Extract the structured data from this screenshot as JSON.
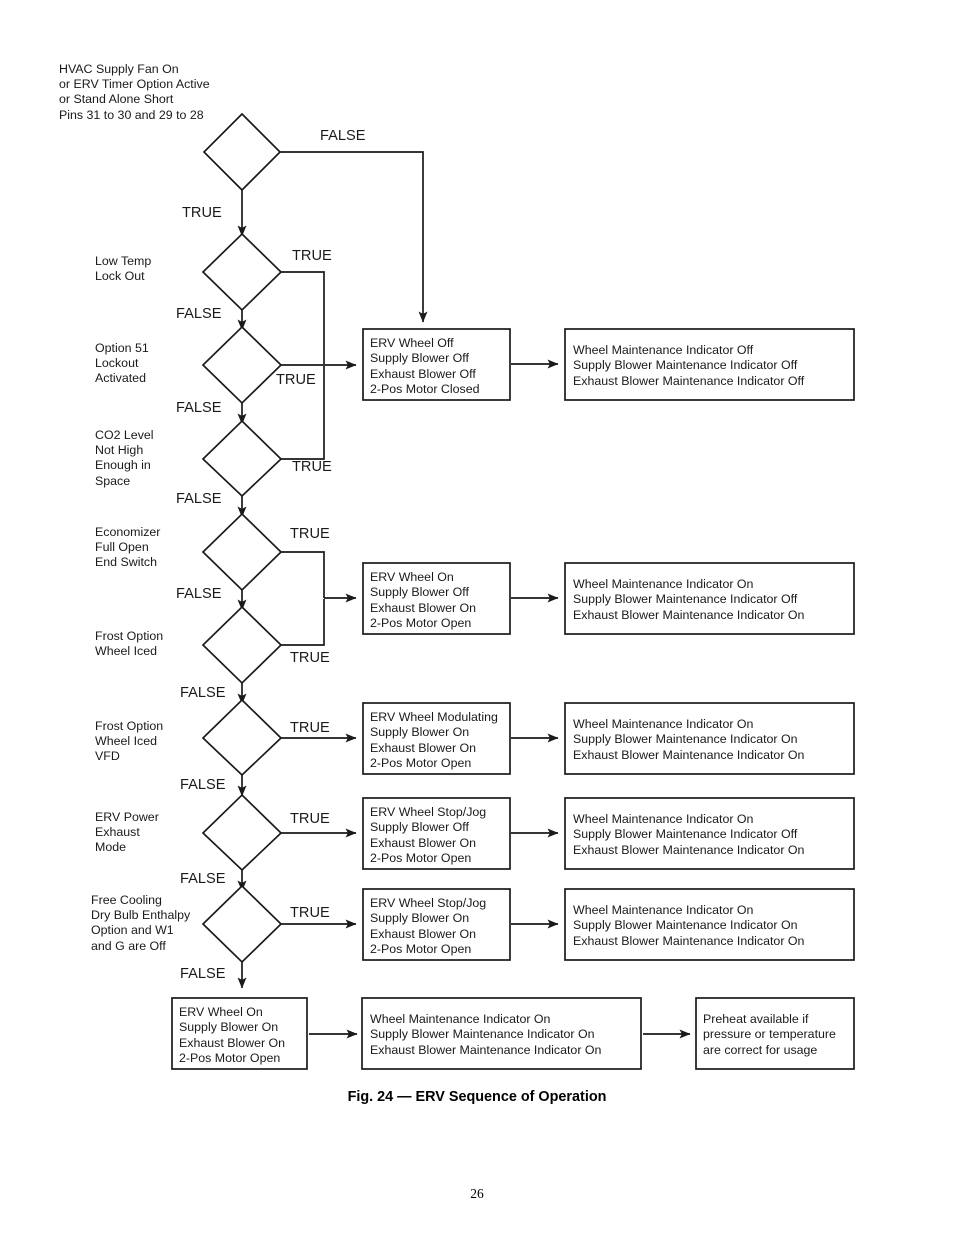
{
  "figure": {
    "caption": "Fig. 24 — ERV Sequence of Operation",
    "page_number": "26"
  },
  "edge_labels": {
    "true": "TRUE",
    "false": "FALSE"
  },
  "decisions": [
    {
      "id": "d1",
      "label": "HVAC Supply Fan On\nor ERV Timer Option Active\nor Stand Alone Short\nPins 31 to 30 and 29 to 28",
      "true_label": "TRUE",
      "false_label": "FALSE"
    },
    {
      "id": "d2",
      "label": "Low Temp\nLock Out",
      "true_label": "TRUE",
      "false_label": "FALSE"
    },
    {
      "id": "d3",
      "label": "Option 51\nLockout\nActivated",
      "true_label": "TRUE",
      "false_label": "FALSE"
    },
    {
      "id": "d4",
      "label": "CO2 Level\nNot High\nEnough in\nSpace",
      "true_label": "TRUE",
      "false_label": "FALSE"
    },
    {
      "id": "d5",
      "label": "Economizer\nFull Open\nEnd Switch",
      "true_label": "TRUE",
      "false_label": "FALSE"
    },
    {
      "id": "d6",
      "label": "Frost Option\nWheel Iced",
      "true_label": "TRUE",
      "false_label": "FALSE"
    },
    {
      "id": "d7",
      "label": "Frost Option\nWheel Iced\nVFD",
      "true_label": "TRUE",
      "false_label": "FALSE"
    },
    {
      "id": "d8",
      "label": "ERV Power\nExhaust\nMode",
      "true_label": "TRUE",
      "false_label": "FALSE"
    },
    {
      "id": "d9",
      "label": "Free Cooling\nDry Bulb Enthalpy\nOption and W1\nand G are Off",
      "true_label": "TRUE",
      "false_label": "FALSE"
    }
  ],
  "action_boxes": [
    {
      "id": "a1",
      "text": "ERV Wheel Off\nSupply Blower Off\nExhaust Blower Off\n2-Pos Motor Closed"
    },
    {
      "id": "a2",
      "text": "ERV Wheel On\nSupply Blower Off\nExhaust Blower On\n2-Pos Motor Open"
    },
    {
      "id": "a3",
      "text": "ERV Wheel Modulating\nSupply Blower On\nExhaust Blower On\n2-Pos Motor Open"
    },
    {
      "id": "a4",
      "text": "ERV Wheel Stop/Jog\nSupply Blower Off\nExhaust Blower On\n2-Pos Motor Open"
    },
    {
      "id": "a5",
      "text": "ERV Wheel Stop/Jog\nSupply Blower On\nExhaust Blower On\n2-Pos Motor Open"
    },
    {
      "id": "a6",
      "text": "ERV Wheel On\nSupply Blower On\nExhaust Blower On\n2-Pos Motor Open"
    }
  ],
  "indicator_boxes": [
    {
      "id": "i1",
      "text": "Wheel Maintenance Indicator Off\nSupply Blower Maintenance Indicator Off\nExhaust Blower Maintenance Indicator Off"
    },
    {
      "id": "i2",
      "text": "Wheel Maintenance Indicator On\nSupply Blower Maintenance Indicator Off\nExhaust Blower Maintenance Indicator On"
    },
    {
      "id": "i3",
      "text": "Wheel Maintenance Indicator On\nSupply Blower Maintenance Indicator On\nExhaust Blower Maintenance Indicator On"
    },
    {
      "id": "i4",
      "text": "Wheel Maintenance Indicator On\nSupply Blower Maintenance Indicator Off\nExhaust Blower Maintenance Indicator On"
    },
    {
      "id": "i5",
      "text": "Wheel Maintenance Indicator On\nSupply Blower Maintenance Indicator On\nExhaust Blower Maintenance Indicator On"
    },
    {
      "id": "i6",
      "text": "Wheel Maintenance Indicator On\nSupply Blower Maintenance Indicator On\nExhaust Blower Maintenance Indicator On"
    }
  ],
  "terminal_box": {
    "id": "t1",
    "text": "Preheat available if\npressure or temperature\nare correct for usage"
  },
  "colors": {
    "line": "#1a1a1a",
    "text": "#1a1a1a",
    "background": "#ffffff"
  }
}
